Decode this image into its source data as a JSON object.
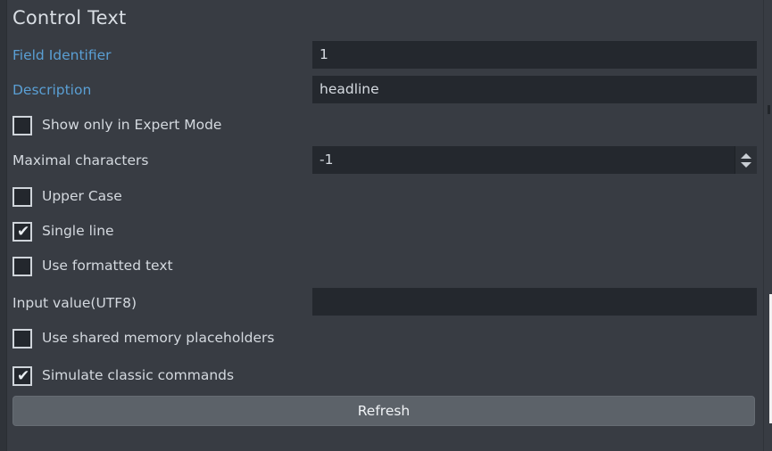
{
  "panel": {
    "title": "Control Text",
    "refresh_button": "Refresh"
  },
  "fields": {
    "field_identifier": {
      "label": "Field Identifier",
      "value": "1",
      "placeholder": ""
    },
    "description": {
      "label": "Description",
      "value": "headline",
      "placeholder": ""
    },
    "maximal_characters": {
      "label": "Maximal characters",
      "value": "-1",
      "min_hint": "",
      "spinner_up": "▲",
      "spinner_down": "▼"
    },
    "input_value_utf8": {
      "label": "Input value(UTF8)",
      "value": "",
      "placeholder": ""
    }
  },
  "checkboxes": [
    {
      "label": "Show only in Expert Mode",
      "checked": false,
      "mark": "✔"
    },
    {
      "label": "Upper Case",
      "checked": false,
      "mark": "✔"
    },
    {
      "label": "Single line",
      "checked": true,
      "mark": "✔"
    },
    {
      "label": "Use formatted text",
      "checked": false,
      "mark": "✔"
    },
    {
      "label": "Use shared memory placeholders",
      "checked": false,
      "mark": "✔"
    },
    {
      "label": "Simulate classic commands",
      "checked": true,
      "mark": "✔"
    }
  ],
  "colors": {
    "panel_background": "#383c43",
    "field_background": "#24282e",
    "link_label": "#5a9fd4",
    "plain_label": "#d4d9df",
    "button_background": "#5c6269",
    "checkbox_border": "#cfd4da"
  }
}
